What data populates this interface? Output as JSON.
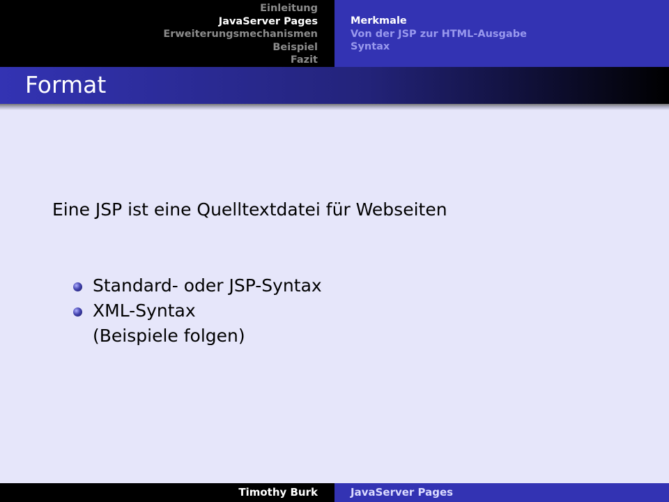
{
  "header": {
    "sections": [
      {
        "label": "Einleitung",
        "active": false
      },
      {
        "label": "JavaServer Pages",
        "active": true
      },
      {
        "label": "Erweiterungsmechanismen",
        "active": false
      },
      {
        "label": "Beispiel",
        "active": false
      },
      {
        "label": "Fazit",
        "active": false
      }
    ],
    "subsections": [
      {
        "label": "Merkmale",
        "active": true
      },
      {
        "label": "Von der JSP zur HTML-Ausgabe",
        "active": false
      },
      {
        "label": "Syntax",
        "active": false
      }
    ]
  },
  "frame": {
    "title": "Format",
    "intro": "Eine JSP ist eine Quelltextdatei für Webseiten",
    "items": [
      {
        "label": "Standard- oder JSP-Syntax",
        "sub": ""
      },
      {
        "label": "XML-Syntax",
        "sub": "(Beispiele folgen)"
      }
    ]
  },
  "footer": {
    "author": "Timothy Burk",
    "title": "JavaServer Pages"
  },
  "colors": {
    "accent": "#3333b3",
    "background": "#e6e6fa",
    "header_left": "#000000"
  }
}
